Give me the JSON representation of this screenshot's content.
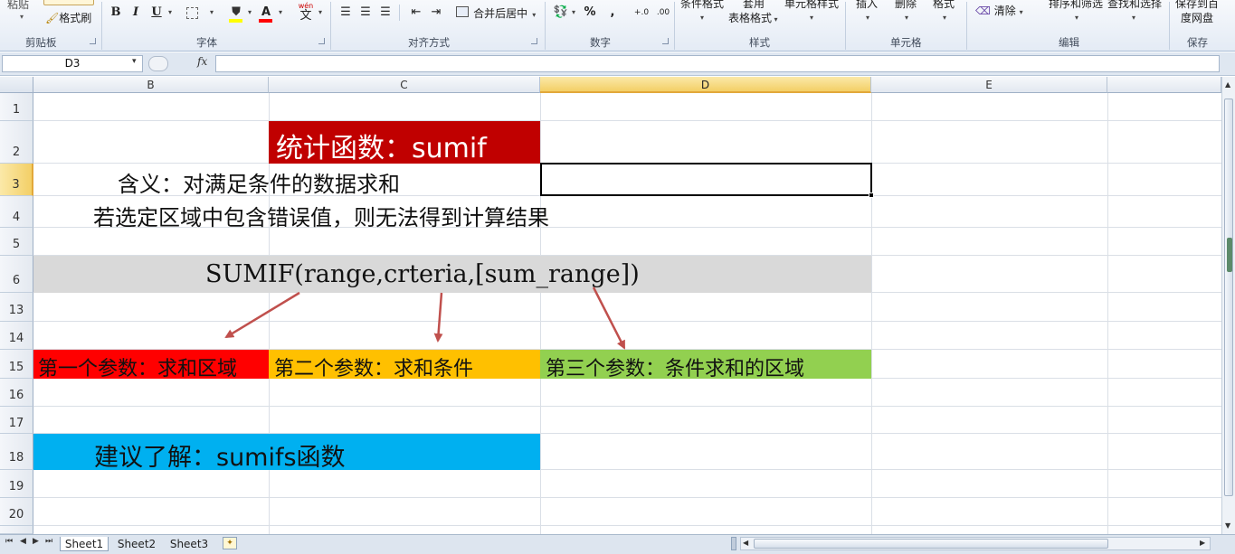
{
  "ribbon": {
    "paste_label": "粘贴",
    "format_painter_label": "格式刷",
    "groups": {
      "clipboard": "剪贴板",
      "font": "字体",
      "alignment": "对齐方式",
      "number": "数字",
      "styles": "样式",
      "cells": "单元格",
      "editing": "编辑",
      "save": "保存"
    },
    "bold": "B",
    "italic": "I",
    "underline": "U",
    "wen_label": "wén",
    "wen_char": "文",
    "merge_center": "合并后居中",
    "percent": "%",
    "comma": ",",
    "conditional_format": "条件格式",
    "table_format_1": "套用",
    "table_format_2": "表格格式",
    "cell_styles": "单元格样式",
    "insert": "插入",
    "delete": "删除",
    "format": "格式",
    "clear": "清除",
    "sort_filter": "排序和筛选",
    "find_select": "查找和选择",
    "save_baidu_1": "保存到百",
    "save_baidu_2": "度网盘"
  },
  "formula_bar": {
    "name_box": "D3",
    "fx": "fx",
    "formula": ""
  },
  "grid": {
    "columns": [
      "B",
      "C",
      "D",
      "E"
    ],
    "rows": [
      "1",
      "2",
      "3",
      "4",
      "5",
      "6",
      "13",
      "14",
      "15",
      "16",
      "17",
      "18",
      "19",
      "20"
    ],
    "selected_cell": "D3",
    "selected_column": "D"
  },
  "cells": {
    "title": "统计函数：sumif",
    "meaning": "含义：对满足条件的数据求和",
    "error_note": "若选定区域中包含错误值，则无法得到计算结果",
    "syntax": "SUMIF(range,crteria,[sum_range])",
    "param1": "第一个参数：求和区域",
    "param2": "第二个参数：求和条件",
    "param3": "第三个参数：条件求和的区域",
    "suggestion": "建议了解：sumifs函数"
  },
  "colors": {
    "title_bg": "#c00000",
    "syntax_bg": "#d9d9d9",
    "param1_bg": "#ff0000",
    "param2_bg": "#ffc000",
    "param3_bg": "#92d050",
    "suggestion_bg": "#00b0f0",
    "arrow": "#c0504d"
  },
  "sheets": [
    "Sheet1",
    "Sheet2",
    "Sheet3"
  ]
}
